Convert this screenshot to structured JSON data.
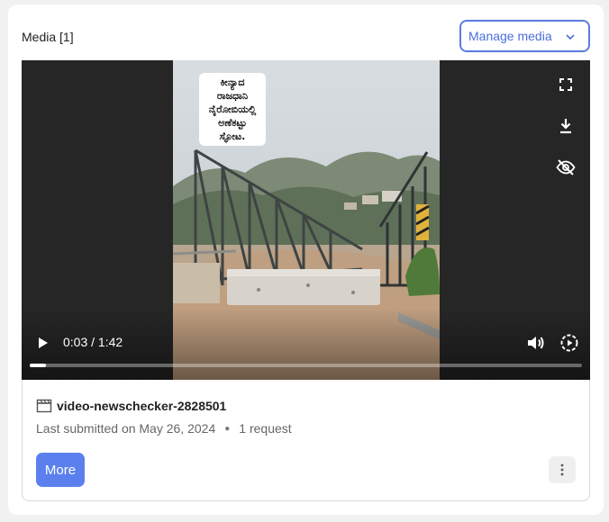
{
  "header": {
    "title": "Media [1]",
    "manage_label": "Manage media"
  },
  "player": {
    "current_time": "0:03",
    "duration": "1:42",
    "time_display": "0:03 / 1:42",
    "progress_fraction": 0.03,
    "caption_lines": [
      "ಕೀನ್ಯಾದ",
      "ರಾಜಧಾನಿ",
      "ನೈರೋಬಿಯಲ್ಲಿ",
      "ಅಣೆಕಟ್ಟು",
      "ಸ್ಫೋಟ."
    ],
    "icons": {
      "fullscreen": "fullscreen-icon",
      "download": "download-icon",
      "hide": "eye-off-icon",
      "play": "play-icon",
      "volume": "volume-icon",
      "speed": "playback-speed-icon"
    }
  },
  "item": {
    "file_icon": "clapperboard-icon",
    "name": "video-newschecker-2828501",
    "submitted": "Last submitted on May 26, 2024",
    "requests": "1 request",
    "more_label": "More",
    "kebab_icon": "more-vertical-icon"
  },
  "colors": {
    "accent": "#5b80ee",
    "manage_border": "#5a7de0"
  }
}
